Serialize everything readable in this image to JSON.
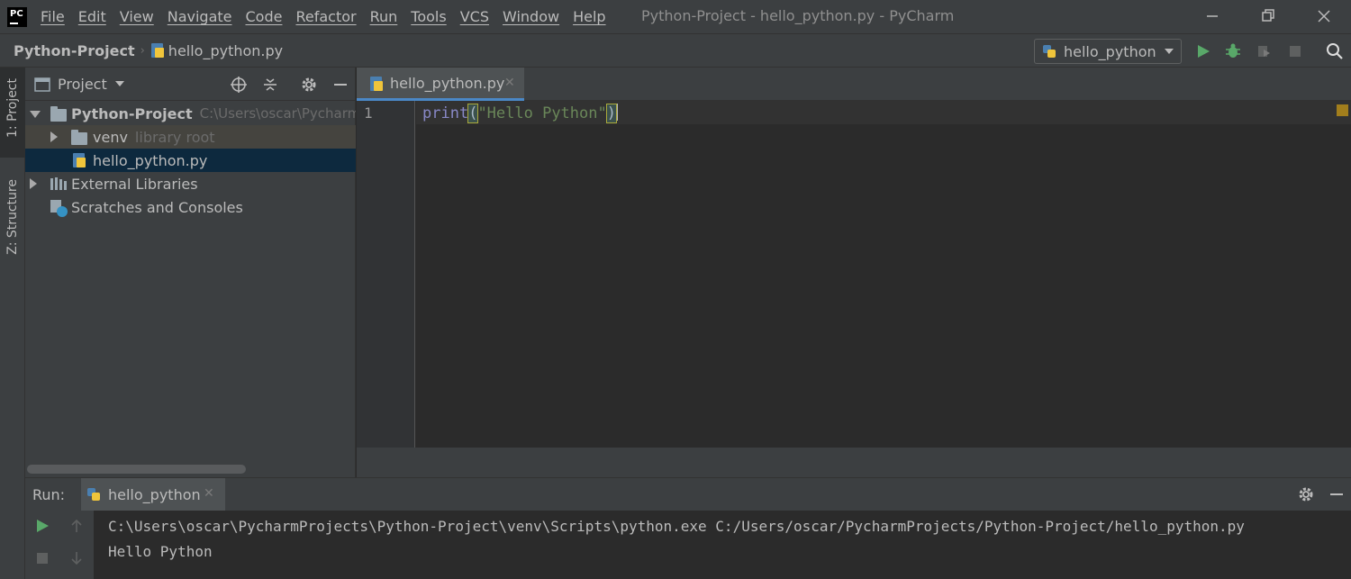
{
  "app": {
    "logo_text": "PC",
    "window_title": "Python-Project - hello_python.py - PyCharm",
    "menu": [
      "File",
      "Edit",
      "View",
      "Navigate",
      "Code",
      "Refactor",
      "Run",
      "Tools",
      "VCS",
      "Window",
      "Help"
    ]
  },
  "navbar": {
    "project": "Python-Project",
    "file": "hello_python.py",
    "run_config": "hello_python"
  },
  "left_strip": {
    "project_tab": "1: Project",
    "structure_tab": "Z: Structure"
  },
  "project_panel": {
    "title": "Project",
    "tree": [
      {
        "label": "Python-Project",
        "hint": "C:\\Users\\oscar\\Pycharm",
        "bold": true
      },
      {
        "label": "venv",
        "hint": "library root"
      },
      {
        "label": "hello_python.py",
        "selected": true
      },
      {
        "label": "External Libraries"
      },
      {
        "label": "Scratches and Consoles"
      }
    ]
  },
  "editor": {
    "tab_label": "hello_python.py",
    "line_number": "1",
    "code": {
      "fn": "print",
      "open": "(",
      "string": "\"Hello Python\"",
      "close": ")"
    }
  },
  "run_panel": {
    "label": "Run:",
    "tab_label": "hello_python",
    "console_lines": [
      "C:\\Users\\oscar\\PycharmProjects\\Python-Project\\venv\\Scripts\\python.exe C:/Users/oscar/PycharmProjects/Python-Project/hello_python.py",
      "Hello Python"
    ]
  },
  "colors": {
    "accent": "#4a88c7",
    "run_green": "#59a869",
    "selection": "#0d293e"
  }
}
